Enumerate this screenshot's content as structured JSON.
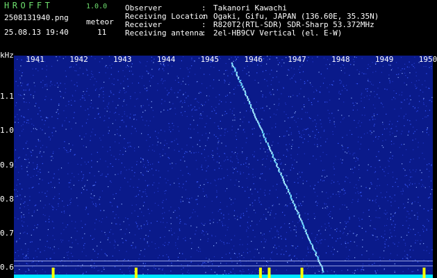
{
  "app": {
    "logo": "HROFFT",
    "version": "1.0.0",
    "filename": "2508131940.png",
    "datetime": "25.08.13 19:40",
    "meteor_label": "meteor",
    "meteor_count": "11"
  },
  "station": [
    {
      "label": "Observer",
      "value": "Takanori Kawachi"
    },
    {
      "label": "Receiving Location",
      "value": "Ogaki, Gifu, JAPAN (136.60E, 35.35N)"
    },
    {
      "label": "Receiver",
      "value": "R820T2(RTL-SDR) SDR-Sharp 53.372MHz"
    },
    {
      "label": "Receiving antenna",
      "value": "2el-HB9CV Vertical (el. E-W)"
    }
  ],
  "separator": ":",
  "chart_data": {
    "type": "heatmap",
    "title": "",
    "xlabel": "",
    "ylabel": "kHz",
    "x_ticks": [
      "1941",
      "1942",
      "1943",
      "1944",
      "1945",
      "1946",
      "1947",
      "1948",
      "1949",
      "1950"
    ],
    "y_ticks": [
      "1.1",
      "1.0",
      "0.9",
      "0.8",
      "0.7",
      "0.6"
    ],
    "y_range": [
      0.57,
      1.22
    ],
    "x_range": [
      1940.5,
      1950.1
    ],
    "colors": {
      "background": "#0a1a8a",
      "noise": "#3a5cff",
      "signal": "#9fe8ff",
      "baseline": "#00e8ff",
      "burst": "#ffff00"
    },
    "meteor_trace": {
      "start": {
        "minute": 1945.5,
        "khz": 1.2
      },
      "end": {
        "minute": 1947.6,
        "khz": 0.59
      }
    },
    "baseline_khz": 0.58,
    "reference_lines_khz": [
      0.62,
      0.605
    ],
    "bursts_minute": [
      1941.4,
      1943.3,
      1946.15,
      1946.35,
      1947.1,
      1949.9
    ]
  }
}
